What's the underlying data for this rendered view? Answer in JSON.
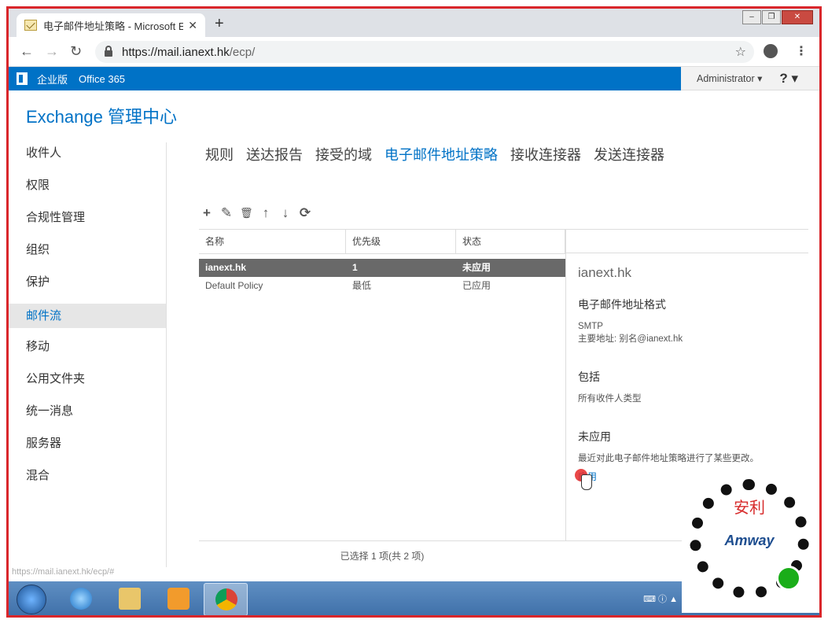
{
  "browser": {
    "tab_title": "电子邮件地址策略 - Microsoft E",
    "tab_close": "✕",
    "new_tab": "+",
    "url_host": "https://mail.ianext.hk",
    "url_path": "/ecp/",
    "status_url": "https://mail.ianext.hk/ecp/#"
  },
  "o365_bar": {
    "edition": "企业版",
    "product": "Office 365",
    "user": "Administrator ▾",
    "help": "? ▾"
  },
  "eac": {
    "title": "Exchange 管理中心"
  },
  "left_nav": [
    {
      "label": "收件人"
    },
    {
      "label": "权限"
    },
    {
      "label": "合规性管理"
    },
    {
      "label": "组织"
    },
    {
      "label": "保护"
    },
    {
      "label": "邮件流"
    },
    {
      "label": "移动"
    },
    {
      "label": "公用文件夹"
    },
    {
      "label": "统一消息"
    },
    {
      "label": "服务器"
    },
    {
      "label": "混合"
    }
  ],
  "sub_tabs": [
    {
      "label": "规则"
    },
    {
      "label": "送达报告"
    },
    {
      "label": "接受的域"
    },
    {
      "label": "电子邮件地址策略"
    },
    {
      "label": "接收连接器"
    },
    {
      "label": "发送连接器"
    }
  ],
  "toolbar": {
    "add": "+",
    "edit": "✎",
    "delete": "🗑",
    "up": "↑",
    "down": "↓",
    "refresh": "⟳"
  },
  "list": {
    "columns": [
      "名称",
      "优先级",
      "状态"
    ],
    "rows": [
      {
        "name": "ianext.hk",
        "priority": "1",
        "status": "未应用"
      },
      {
        "name": "Default Policy",
        "priority": "最低",
        "status": "已应用"
      }
    ],
    "footer": "已选择 1 项(共 2 项)"
  },
  "details": {
    "title": "ianext.hk",
    "format_heading": "电子邮件地址格式",
    "format_type": "SMTP",
    "format_primary": "主要地址: 别名@ianext.hk",
    "include_heading": "包括",
    "include_value": "所有收件人类型",
    "status_heading": "未应用",
    "status_text": "最近对此电子邮件地址策略进行了某些更改。",
    "apply_link": "应用"
  },
  "overlay": {
    "brand": "Amway",
    "brand_cn": "安利"
  },
  "colors": {
    "accent": "#0072c6",
    "selected_row": "#696969",
    "frame_border": "#d9262b"
  }
}
